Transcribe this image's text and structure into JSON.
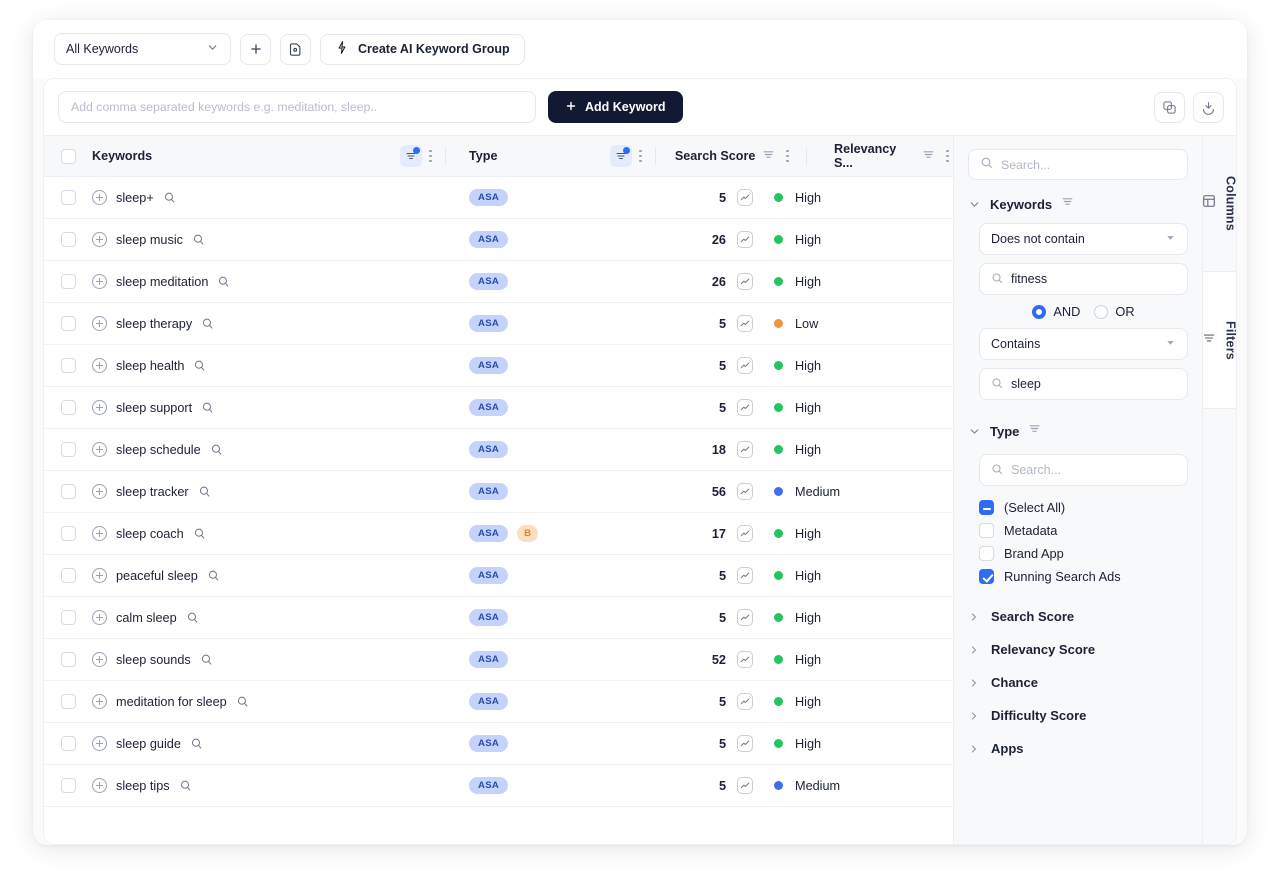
{
  "toolbar": {
    "keyword_group_value": "All Keywords",
    "add_group_label": "+",
    "create_ai_label": "Create AI Keyword Group"
  },
  "search_bar": {
    "placeholder": "Add comma separated keywords e.g. meditation, sleep..",
    "value": "",
    "add_keyword_label": "Add Keyword"
  },
  "table": {
    "columns": {
      "keywords": "Keywords",
      "type": "Type",
      "search_score": "Search Score",
      "relevancy_score": "Relevancy S..."
    },
    "rows": [
      {
        "keyword": "sleep+",
        "types": [
          "ASA"
        ],
        "search_score": "5",
        "relevancy": "High",
        "relevancy_color": "#22c55e"
      },
      {
        "keyword": "sleep music",
        "types": [
          "ASA"
        ],
        "search_score": "26",
        "relevancy": "High",
        "relevancy_color": "#22c55e"
      },
      {
        "keyword": "sleep meditation",
        "types": [
          "ASA"
        ],
        "search_score": "26",
        "relevancy": "High",
        "relevancy_color": "#22c55e"
      },
      {
        "keyword": "sleep therapy",
        "types": [
          "ASA"
        ],
        "search_score": "5",
        "relevancy": "Low",
        "relevancy_color": "#f0943f"
      },
      {
        "keyword": "sleep health",
        "types": [
          "ASA"
        ],
        "search_score": "5",
        "relevancy": "High",
        "relevancy_color": "#22c55e"
      },
      {
        "keyword": "sleep support",
        "types": [
          "ASA"
        ],
        "search_score": "5",
        "relevancy": "High",
        "relevancy_color": "#22c55e"
      },
      {
        "keyword": "sleep schedule",
        "types": [
          "ASA"
        ],
        "search_score": "18",
        "relevancy": "High",
        "relevancy_color": "#22c55e"
      },
      {
        "keyword": "sleep tracker",
        "types": [
          "ASA"
        ],
        "search_score": "56",
        "relevancy": "Medium",
        "relevancy_color": "#3b6ff0"
      },
      {
        "keyword": "sleep coach",
        "types": [
          "ASA",
          "B"
        ],
        "search_score": "17",
        "relevancy": "High",
        "relevancy_color": "#22c55e"
      },
      {
        "keyword": "peaceful sleep",
        "types": [
          "ASA"
        ],
        "search_score": "5",
        "relevancy": "High",
        "relevancy_color": "#22c55e"
      },
      {
        "keyword": "calm sleep",
        "types": [
          "ASA"
        ],
        "search_score": "5",
        "relevancy": "High",
        "relevancy_color": "#22c55e"
      },
      {
        "keyword": "sleep sounds",
        "types": [
          "ASA"
        ],
        "search_score": "52",
        "relevancy": "High",
        "relevancy_color": "#22c55e"
      },
      {
        "keyword": "meditation for sleep",
        "types": [
          "ASA"
        ],
        "search_score": "5",
        "relevancy": "High",
        "relevancy_color": "#22c55e"
      },
      {
        "keyword": "sleep guide",
        "types": [
          "ASA"
        ],
        "search_score": "5",
        "relevancy": "High",
        "relevancy_color": "#22c55e"
      },
      {
        "keyword": "sleep tips",
        "types": [
          "ASA"
        ],
        "search_score": "5",
        "relevancy": "Medium",
        "relevancy_color": "#3b6ff0"
      }
    ]
  },
  "filter_panel": {
    "search_placeholder": "Search...",
    "keywords_section": {
      "title": "Keywords",
      "condition_1": "Does not contain",
      "value_1": "fitness",
      "operator_and": "AND",
      "operator_or": "OR",
      "condition_2": "Contains",
      "value_2": "sleep"
    },
    "type_section": {
      "title": "Type",
      "search_placeholder": "Search...",
      "options": [
        {
          "label": "(Select All)",
          "state": "indeterminate"
        },
        {
          "label": "Metadata",
          "state": "unchecked"
        },
        {
          "label": "Brand App",
          "state": "unchecked"
        },
        {
          "label": "Running Search Ads",
          "state": "checked"
        }
      ]
    },
    "collapsed_sections": [
      {
        "label": "Search Score"
      },
      {
        "label": "Relevancy Score"
      },
      {
        "label": "Chance"
      },
      {
        "label": "Difficulty Score"
      },
      {
        "label": "Apps"
      }
    ]
  },
  "side_tabs": {
    "columns": "Columns",
    "filters": "Filters"
  },
  "colors": {
    "accent_blue": "#2f6bf5",
    "dark_button": "#121a33",
    "high_green": "#22c55e",
    "medium_blue": "#3b6ff0",
    "low_orange": "#f0943f",
    "badge_asa_bg": "#c3d3fb",
    "badge_b_bg": "#fcdfc0"
  }
}
